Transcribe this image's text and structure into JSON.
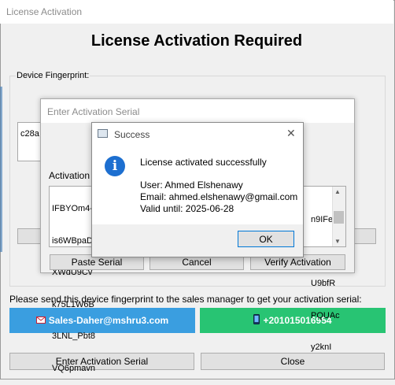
{
  "window": {
    "title": "License Activation",
    "heading": "License Activation Required"
  },
  "fingerprint": {
    "group_label": "Device Fingerprint:",
    "value_visible": "c28a"
  },
  "send_note": "Please send this device fingerprint to the sales manager to get your activation serial:",
  "contact": {
    "email_label": "Sales-Daher@mshru3.com",
    "phone_label": "+201015016954",
    "email_icon": "envelope-icon",
    "phone_icon": "mobile-phone-icon",
    "email_color": "#3a9ee0",
    "phone_color": "#28c473"
  },
  "buttons": {
    "enter_serial": "Enter Activation Serial",
    "close": "Close"
  },
  "serial_dialog": {
    "title": "Enter Activation Serial",
    "label": "Activation S",
    "lines_left": [
      "IFBYOm4-",
      "is6WBpaD",
      "XWdU9Cv",
      "k75L1W6B",
      "3LNL_Pbt8",
      "VQ6pmavn"
    ],
    "lines_right": [
      "n9IFe",
      "",
      "U9bfR",
      "PQUAc",
      "y2knI"
    ],
    "paste": "Paste Serial",
    "cancel": "Cancel",
    "verify": "Verify Activation"
  },
  "message_box": {
    "title": "Success",
    "line1": "License activated successfully",
    "user": "User: Ahmed Elshenawy",
    "email": "Email: ahmed.elshenawy@gmail.com",
    "valid": "Valid until: 2025-06-28",
    "ok": "OK",
    "icon": "info-icon",
    "close_glyph": "✕",
    "info_glyph": "i"
  }
}
